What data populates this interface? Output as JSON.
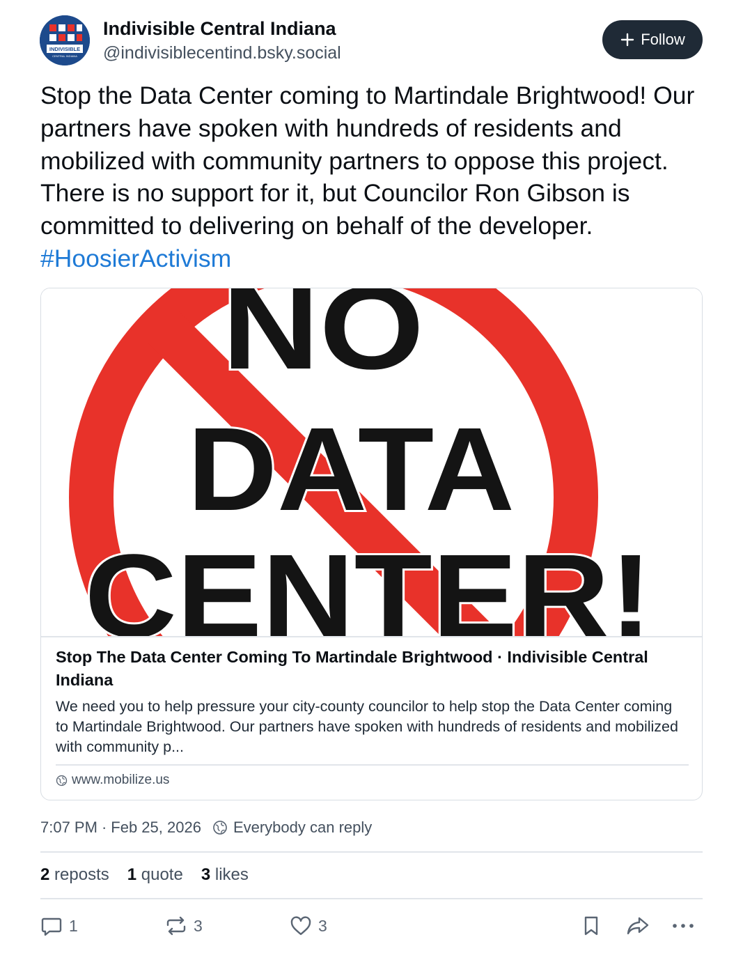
{
  "author": {
    "display_name": "Indivisible Central Indiana",
    "handle": "@indivisiblecentind.bsky.social",
    "avatar_icon": "indivisible-logo-icon",
    "avatar_text": "INDIVISIBLE",
    "avatar_subtext": "CENTRAL INDIANA"
  },
  "follow_button": {
    "label": "Follow",
    "icon": "plus-icon"
  },
  "post": {
    "text": "Stop the Data Center coming to Martindale Brightwood! Our partners have spoken with hundreds of residents and mobilized with community partners to oppose this project. There is no support for it, but Councilor Ron Gibson is committed to delivering on behalf of the developer. ",
    "hashtag": "#HoosierActivism"
  },
  "link_card": {
    "image_lines": [
      "NO",
      "DATA",
      "CENTER!"
    ],
    "title": "Stop The Data Center Coming To Martindale Brightwood · Indivisible Central Indiana",
    "description": "We need you to help pressure your city-county councilor to help stop the Data Center coming to Martindale Brightwood. Our partners have spoken with hundreds of residents and mobilized with community p...",
    "domain": "www.mobilize.us",
    "domain_icon": "globe-icon"
  },
  "meta": {
    "time": "7:07 PM",
    "separator": "·",
    "date": "Feb 25, 2026",
    "reply_setting": "Everybody can reply",
    "reply_setting_icon": "globe-icon"
  },
  "stats": {
    "reposts_count": "2",
    "reposts_label": "reposts",
    "quotes_count": "1",
    "quotes_label": "quote",
    "likes_count": "3",
    "likes_label": "likes"
  },
  "actions": {
    "reply_count": "1",
    "repost_count": "3",
    "like_count": "3"
  },
  "colors": {
    "accent": "#1e7ad6",
    "follow_bg": "#1f2a36",
    "no_sign_red": "#e8322a",
    "image_text": "#141414"
  }
}
